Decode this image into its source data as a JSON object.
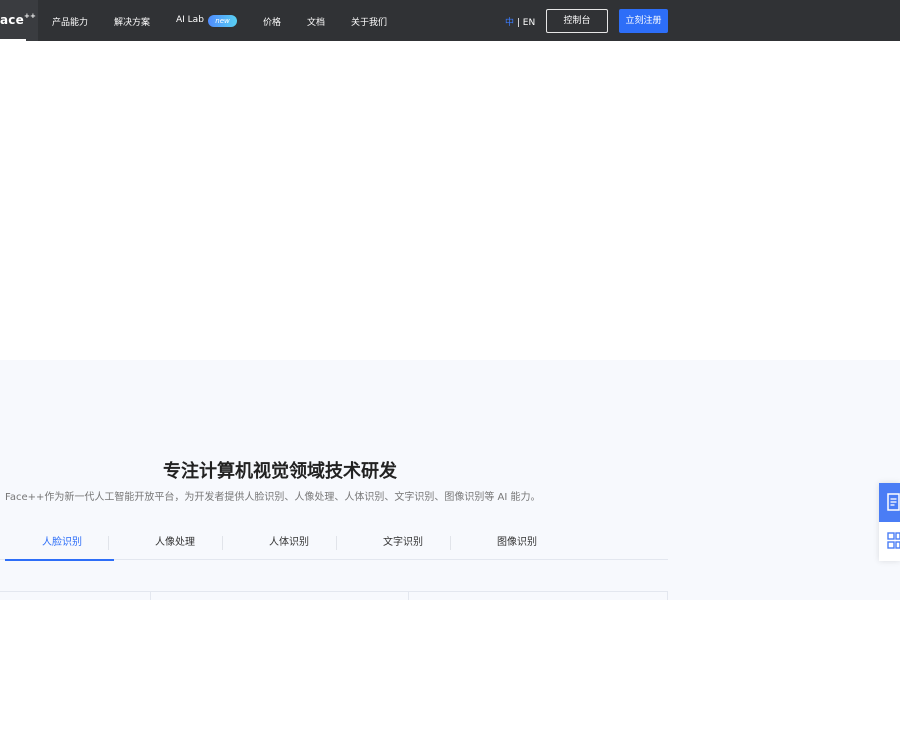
{
  "nav": {
    "logo": {
      "text": "ace",
      "sup": "++"
    },
    "items": [
      {
        "label": "产品能力"
      },
      {
        "label": "解决方案"
      },
      {
        "label": "AI Lab"
      },
      {
        "label": "价格"
      },
      {
        "label": "文档"
      },
      {
        "label": "关于我们"
      }
    ],
    "badge": "new",
    "lang": {
      "zh": "中",
      "sep": " | ",
      "en": "EN"
    },
    "console_label": "控制台",
    "register_label": "立刻注册"
  },
  "section": {
    "title": "专注计算机视觉领域技术研发",
    "subtitle": "Face++作为新一代人工智能开放平台，为开发者提供人脸识别、人像处理、人体识别、文字识别、图像识别等 AI 能力。",
    "tabs": [
      {
        "label": "人脸识别",
        "active": true
      },
      {
        "label": "人像处理",
        "active": false
      },
      {
        "label": "人体识别",
        "active": false
      },
      {
        "label": "文字识别",
        "active": false
      },
      {
        "label": "图像识别",
        "active": false
      }
    ]
  },
  "float_toolbar": {
    "top_icon": "document-icon",
    "bottom_icon": "qr-code-icon"
  },
  "colors": {
    "nav_bg": "#303235",
    "accent": "#2d6ef8",
    "section_bg": "#f7f9fd"
  }
}
